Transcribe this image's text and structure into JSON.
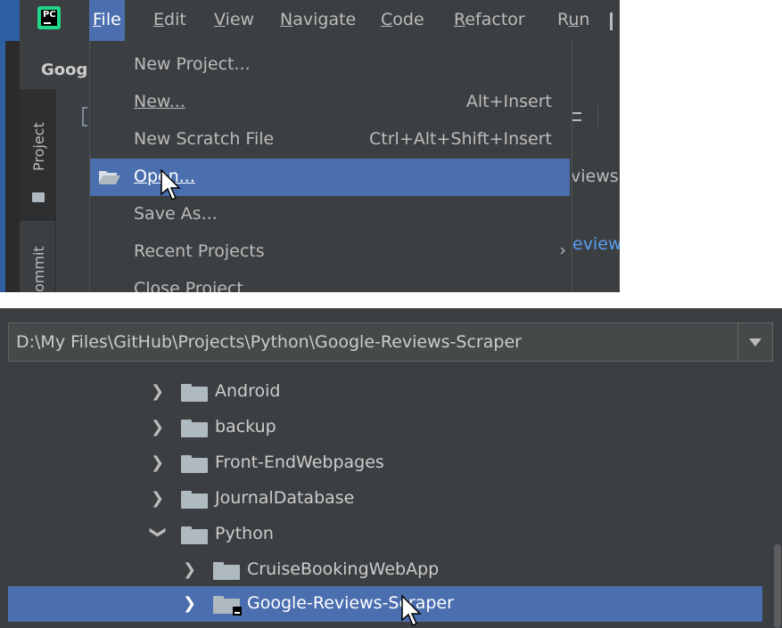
{
  "menubar": {
    "items": [
      "File",
      "Edit",
      "View",
      "Navigate",
      "Code",
      "Refactor",
      "Run"
    ],
    "mnemonics": [
      "F",
      "E",
      "V",
      "N",
      "C",
      "R",
      "u"
    ]
  },
  "tool_window": {
    "project_title_fragment": "Goog",
    "stripe_project": "Project",
    "stripe_commit": "ommit"
  },
  "file_menu": {
    "items": [
      {
        "label": "New Project...",
        "shortcut": ""
      },
      {
        "label": "New...",
        "shortcut": "Alt+Insert"
      },
      {
        "label": "New Scratch File",
        "shortcut": "Ctrl+Alt+Shift+Insert"
      },
      {
        "label": "Open...",
        "shortcut": ""
      },
      {
        "label": "Save As...",
        "shortcut": ""
      },
      {
        "label": "Recent Projects",
        "shortcut": ""
      },
      {
        "label": "Close Project",
        "shortcut": ""
      }
    ]
  },
  "background_fragments": {
    "views": "views.",
    "review": "eview"
  },
  "open_dialog": {
    "path": "D:\\My Files\\GitHub\\Projects\\Python\\Google-Reviews-Scraper",
    "tree": [
      {
        "name": "Android",
        "expanded": false,
        "indent": 0
      },
      {
        "name": "backup",
        "expanded": false,
        "indent": 0
      },
      {
        "name": "Front-EndWebpages",
        "expanded": false,
        "indent": 0
      },
      {
        "name": "JournalDatabase",
        "expanded": false,
        "indent": 0
      },
      {
        "name": "Python",
        "expanded": true,
        "indent": 0
      },
      {
        "name": "CruiseBookingWebApp",
        "expanded": false,
        "indent": 1
      },
      {
        "name": "Google-Reviews-Scraper",
        "expanded": false,
        "indent": 1,
        "selected": true
      }
    ]
  },
  "colors": {
    "accent": "#4b6eaf",
    "background": "#3c3f41",
    "text": "#bbbbbb",
    "link": "#589df6"
  },
  "icons": [
    "pycharm-logo-icon",
    "folder-icon",
    "chevron-right-icon",
    "chevron-down-icon",
    "dropdown-arrow-icon",
    "mouse-cursor-icon",
    "pycharm-project-badge-icon"
  ]
}
